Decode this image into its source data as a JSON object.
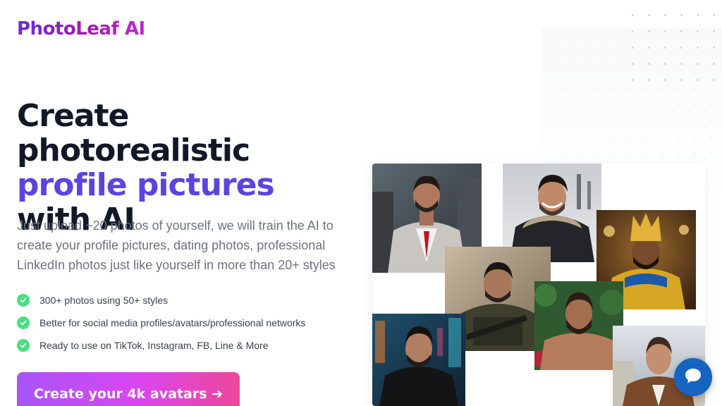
{
  "brand": {
    "name": "PhotoLeaf AI"
  },
  "hero": {
    "headline_line1": "Create photorealistic",
    "headline_line2": "profile pictures",
    "headline_line3": "with AI",
    "description": "Just upload ~20 photos of yourself, we will train the AI to create your profile pictures, dating photos, professional LinkedIn photos just like yourself in more than 20+ styles"
  },
  "features": [
    {
      "text": "300+ photos using 50+ styles"
    },
    {
      "text": "Better for social media profiles/avatars/professional networks"
    },
    {
      "text": "Ready to use on TikTok, Instagram, FB, Line & More"
    }
  ],
  "cta": {
    "label": "Create your 4k avatars ➔"
  },
  "icons": {
    "feature": "check-circle-icon",
    "chat": "chat-bubble-icon"
  },
  "colors": {
    "accent": "#5b45e0",
    "brand_gradient": [
      "#6d28d9",
      "#c026d3"
    ],
    "cta_gradient": [
      "#a855f7",
      "#ec4899"
    ],
    "check": "#4ade80",
    "chat_button": "#1565c0"
  },
  "gallery": {
    "photos": [
      "man-in-tweed-suit",
      "man-in-winter-jacket",
      "man-in-egyptian-costume",
      "man-in-military-gear",
      "man-shirtless-in-forest",
      "man-in-leather-jacket-city",
      "man-in-suit-city"
    ]
  }
}
